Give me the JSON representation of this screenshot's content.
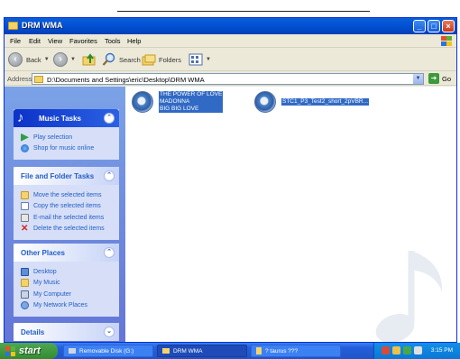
{
  "window": {
    "title": "DRM WMA",
    "menu": [
      "File",
      "Edit",
      "View",
      "Favorites",
      "Tools",
      "Help"
    ]
  },
  "toolbar": {
    "back_label": "Back",
    "search_label": "Search",
    "folders_label": "Folders"
  },
  "address": {
    "label": "Address",
    "value": "D:\\Documents and Settings\\eric\\Desktop\\DRM WMA",
    "go_label": "Go"
  },
  "sidebar": {
    "music_tasks": {
      "title": "Music Tasks",
      "items": [
        {
          "label": "Play selection",
          "icon": "play-icon"
        },
        {
          "label": "Shop for music online",
          "icon": "globe-icon"
        }
      ]
    },
    "file_tasks": {
      "title": "File and Folder Tasks",
      "items": [
        {
          "label": "Move the selected items",
          "icon": "move-icon"
        },
        {
          "label": "Copy the selected items",
          "icon": "copy-icon"
        },
        {
          "label": "E-mail the selected items",
          "icon": "email-icon"
        },
        {
          "label": "Delete the selected items",
          "icon": "delete-icon"
        }
      ]
    },
    "other_places": {
      "title": "Other Places",
      "items": [
        {
          "label": "Desktop",
          "icon": "desktop-icon"
        },
        {
          "label": "My Music",
          "icon": "folder-icon"
        },
        {
          "label": "My Computer",
          "icon": "computer-icon"
        },
        {
          "label": "My Network Places",
          "icon": "network-icon"
        }
      ]
    },
    "details": {
      "title": "Details"
    }
  },
  "files": [
    {
      "lines": [
        "THE POWER OF LOVE",
        "MADONNA",
        "BIG BIG LOVE"
      ]
    },
    {
      "lines": [
        "STC1_P3_Test2_short_2pVBR..."
      ]
    }
  ],
  "taskbar": {
    "start_label": "start",
    "tasks": [
      {
        "label": "Removable Disk (G:)"
      },
      {
        "label": "DRM WMA"
      },
      {
        "label": "? taurus ???"
      }
    ],
    "clock": "3:15 PM"
  },
  "colors": {
    "title_blue": "#0353d6",
    "selection_blue": "#316ac5",
    "taskbar_blue": "#245edb",
    "start_green": "#3c9a3c"
  }
}
